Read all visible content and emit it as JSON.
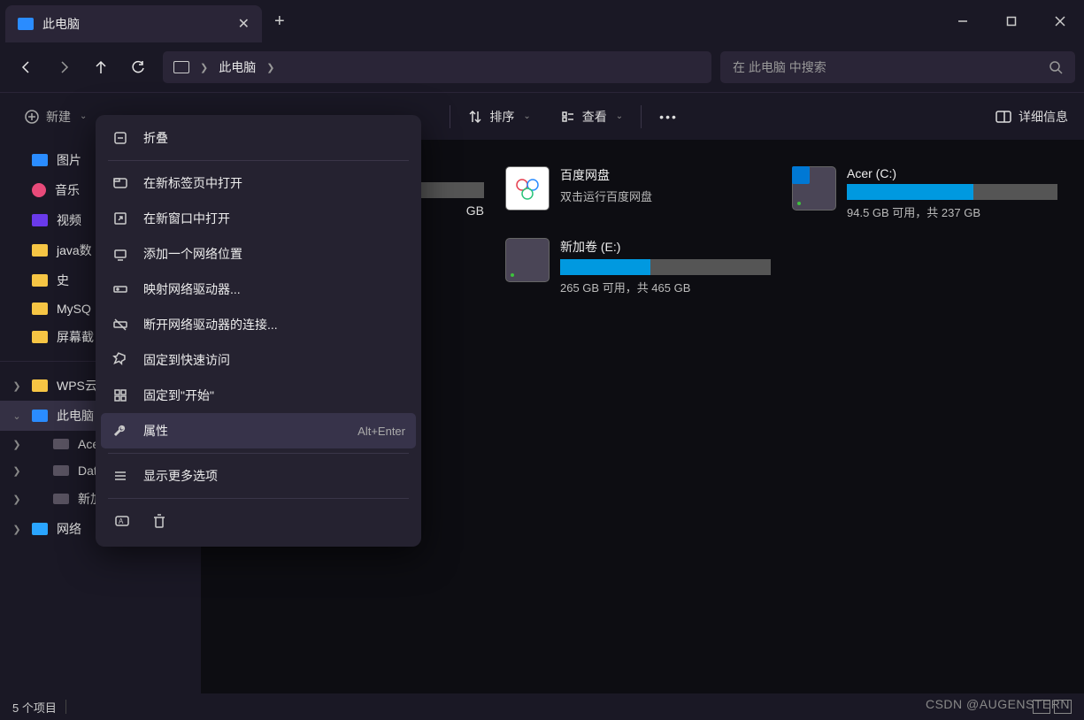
{
  "tab": {
    "title": "此电脑"
  },
  "breadcrumb": {
    "location": "此电脑"
  },
  "search": {
    "placeholder": "在 此电脑 中搜索"
  },
  "toolbar": {
    "new_label": "新建",
    "sort_label": "排序",
    "view_label": "查看",
    "details_label": "详细信息"
  },
  "sidebar": {
    "quick": [
      {
        "label": "图片",
        "icon": "image"
      },
      {
        "label": "音乐",
        "icon": "music"
      },
      {
        "label": "视频",
        "icon": "video"
      },
      {
        "label": "java数",
        "icon": "folder"
      },
      {
        "label": "史",
        "icon": "folder"
      },
      {
        "label": "MySQ",
        "icon": "folder"
      },
      {
        "label": "屏幕截",
        "icon": "folder"
      }
    ],
    "tree": [
      {
        "label": "WPS云",
        "icon": "folder",
        "expanded": false
      },
      {
        "label": "此电脑",
        "icon": "pc",
        "expanded": true,
        "selected": true
      },
      {
        "label": "Acer",
        "icon": "disk",
        "child": true
      },
      {
        "label": "Data (D:)",
        "icon": "disk",
        "child": true
      },
      {
        "label": "新加卷 (E:)",
        "icon": "disk",
        "child": true
      },
      {
        "label": "网络",
        "icon": "net",
        "expanded": false
      }
    ]
  },
  "drives": {
    "partial_stub": {
      "label_suffix": "GB"
    },
    "baidu": {
      "name": "百度网盘",
      "sub": "双击运行百度网盘"
    },
    "acer": {
      "name": "Acer (C:)",
      "info": "94.5 GB 可用，共 237 GB",
      "fill_pct": 60
    },
    "e": {
      "name": "新加卷 (E:)",
      "info": "265 GB 可用，共 465 GB",
      "fill_pct": 43
    }
  },
  "context_menu": {
    "items": [
      {
        "label": "折叠",
        "icon": "collapse"
      },
      {
        "sep": true
      },
      {
        "label": "在新标签页中打开",
        "icon": "tab"
      },
      {
        "label": "在新窗口中打开",
        "icon": "window"
      },
      {
        "label": "添加一个网络位置",
        "icon": "netloc"
      },
      {
        "label": "映射网络驱动器...",
        "icon": "mapnet"
      },
      {
        "label": "断开网络驱动器的连接...",
        "icon": "disconnect"
      },
      {
        "label": "固定到快速访问",
        "icon": "pin"
      },
      {
        "label": "固定到\"开始\"",
        "icon": "pinstart"
      },
      {
        "label": "属性",
        "icon": "wrench",
        "shortcut": "Alt+Enter",
        "hover": true
      },
      {
        "sep": true
      },
      {
        "label": "显示更多选项",
        "icon": "more"
      }
    ]
  },
  "statusbar": {
    "count": "5 个项目"
  },
  "watermark": "CSDN @AUGENSTERN"
}
